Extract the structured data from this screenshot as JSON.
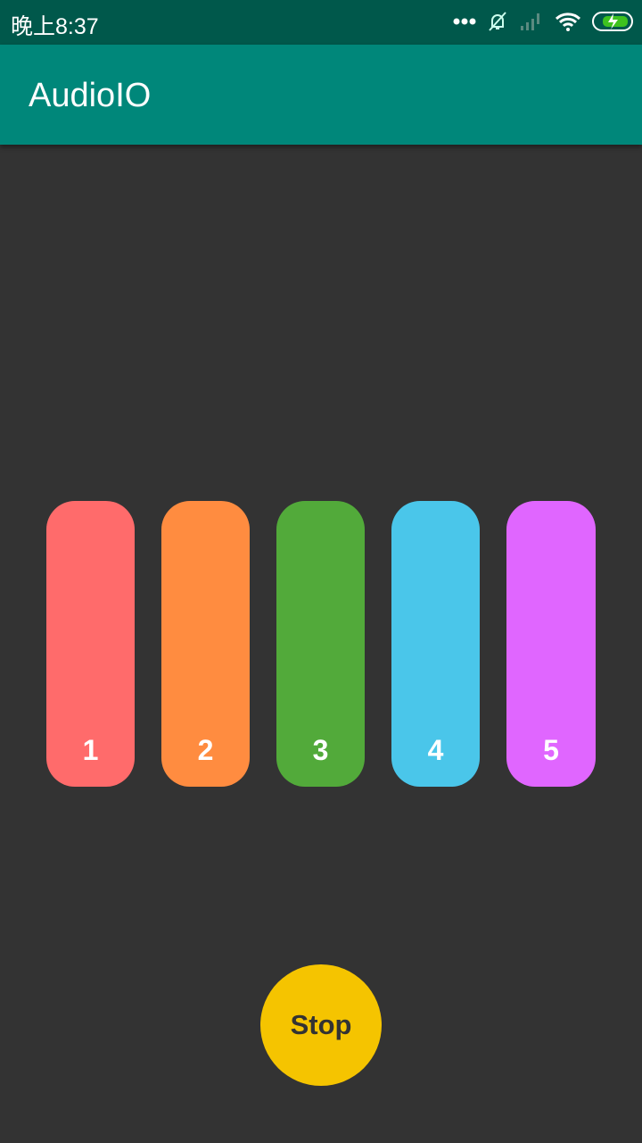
{
  "status": {
    "time": "晚上8:37",
    "icons": [
      "more-dots-icon",
      "notifications-off-icon",
      "signal-icon",
      "wifi-icon",
      "battery-charging-icon"
    ]
  },
  "appbar": {
    "title": "AudioIO"
  },
  "keys": [
    {
      "label": "1",
      "color": "#ff6b6b"
    },
    {
      "label": "2",
      "color": "#ff8c40"
    },
    {
      "label": "3",
      "color": "#52aa3a"
    },
    {
      "label": "4",
      "color": "#4ac6ea"
    },
    {
      "label": "5",
      "color": "#e066ff"
    }
  ],
  "stop_label": "Stop"
}
